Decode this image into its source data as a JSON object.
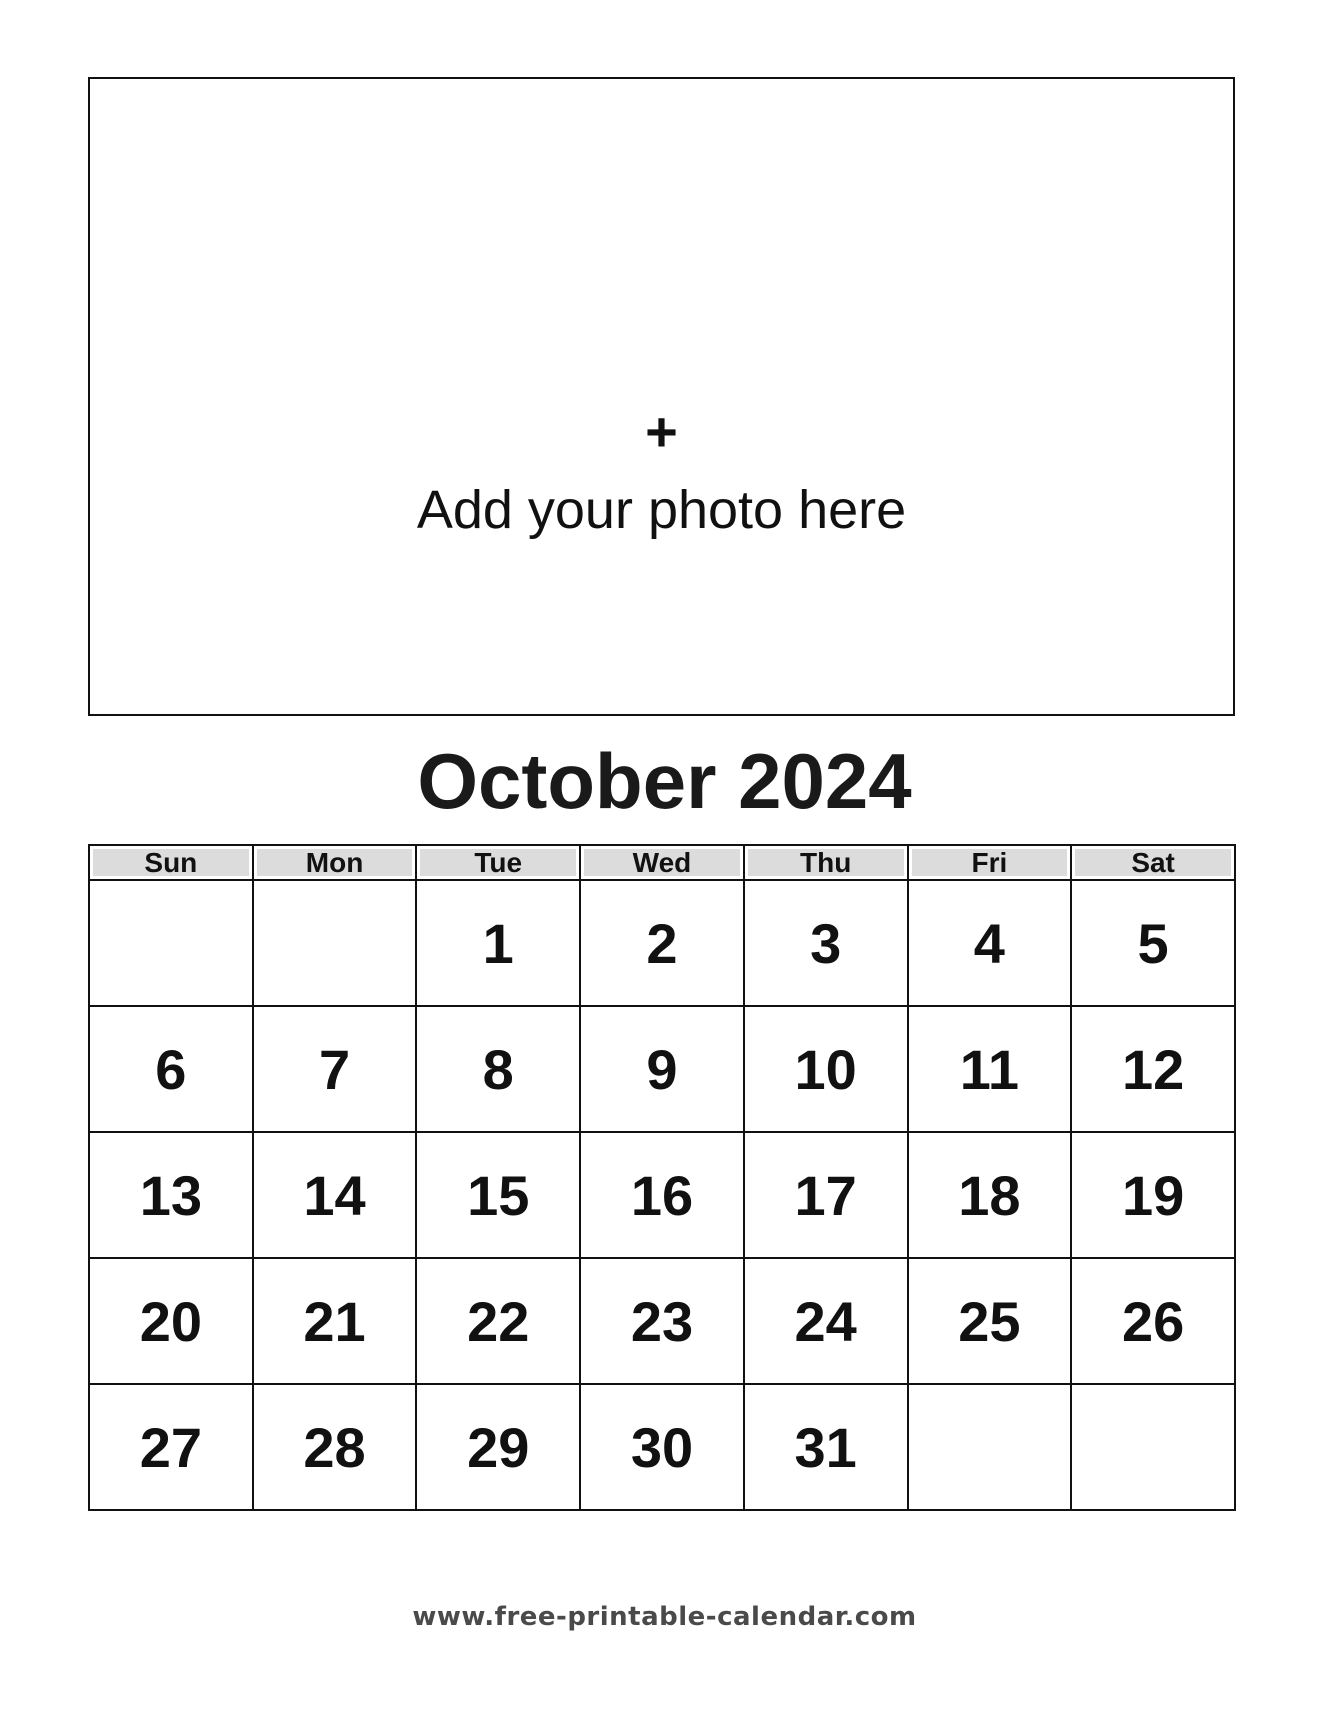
{
  "photo_placeholder": {
    "icon": "plus-icon",
    "plus_glyph": "+",
    "label": "Add your photo here"
  },
  "calendar": {
    "title": "October 2024",
    "month": "October",
    "year": 2024,
    "weekdays": [
      "Sun",
      "Mon",
      "Tue",
      "Wed",
      "Thu",
      "Fri",
      "Sat"
    ],
    "weeks": [
      [
        "",
        "",
        "1",
        "2",
        "3",
        "4",
        "5"
      ],
      [
        "6",
        "7",
        "8",
        "9",
        "10",
        "11",
        "12"
      ],
      [
        "13",
        "14",
        "15",
        "16",
        "17",
        "18",
        "19"
      ],
      [
        "20",
        "21",
        "22",
        "23",
        "24",
        "25",
        "26"
      ],
      [
        "27",
        "28",
        "29",
        "30",
        "31",
        "",
        ""
      ]
    ]
  },
  "footer": {
    "website": "www.free-printable-calendar.com"
  },
  "colors": {
    "header_bg": "#dcdcdc",
    "border": "#111111",
    "footer_text": "#4a4a4a"
  }
}
